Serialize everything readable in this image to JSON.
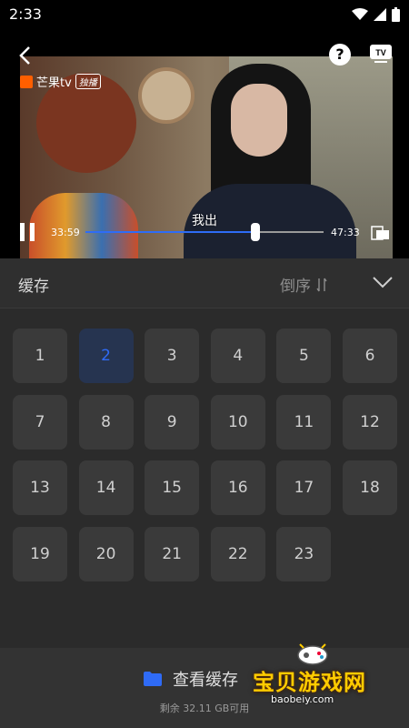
{
  "status_bar": {
    "time": "2:33"
  },
  "video": {
    "logo_text": "芒果tv",
    "logo_badge": "独播",
    "subtitle": "我出",
    "current_time": "33:59",
    "duration": "47:33",
    "progress": 0.715
  },
  "panel": {
    "title": "缓存",
    "sort_label": "倒序"
  },
  "episodes": [
    "1",
    "2",
    "3",
    "4",
    "5",
    "6",
    "7",
    "8",
    "9",
    "10",
    "11",
    "12",
    "13",
    "14",
    "15",
    "16",
    "17",
    "18",
    "19",
    "20",
    "21",
    "22",
    "23"
  ],
  "selected_episode": "2",
  "footer": {
    "view_cache_label": "查看缓存",
    "storage_text": "剩余 32.11 GB可用"
  },
  "watermark": {
    "text": "宝贝游戏网",
    "url": "baobeiy.com"
  },
  "colors": {
    "accent": "#2f6bf6",
    "background": "#2b2b2b",
    "cell": "#3a3a3a"
  }
}
